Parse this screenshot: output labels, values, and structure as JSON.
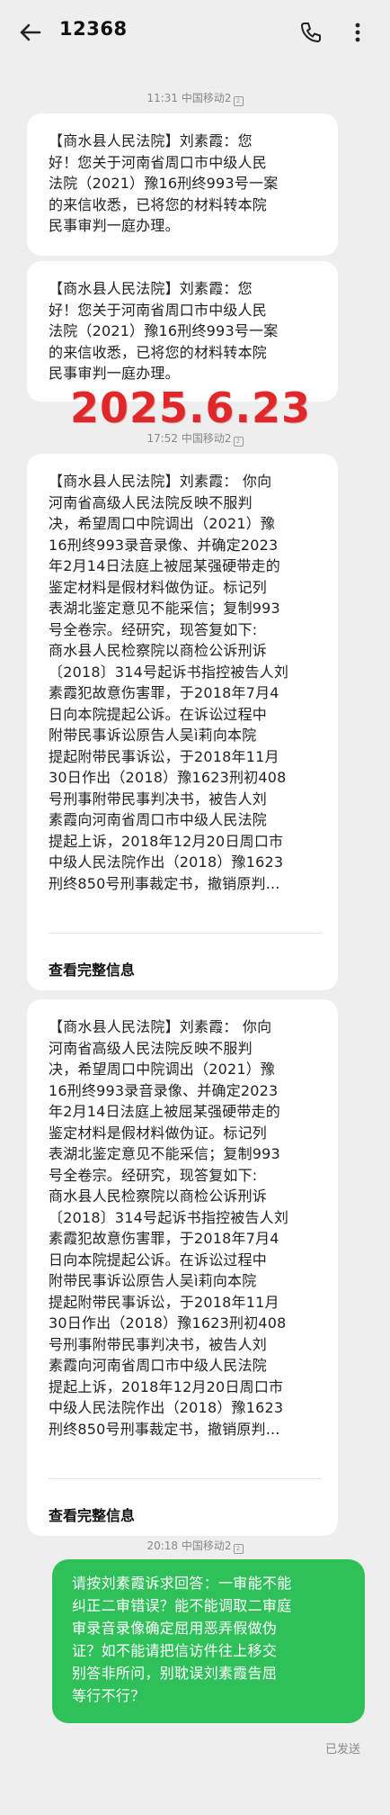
{
  "header": {
    "title": "12368",
    "back_icon": "back-arrow-icon",
    "call_icon": "phone-icon",
    "menu_icon": "more-vertical-icon"
  },
  "timestamps": {
    "t1": "11:31",
    "t2": "17:52",
    "t3": "20:18",
    "carrier": "中国移动2"
  },
  "stamp_date": "2025.6.23",
  "messages": {
    "m1": "【商水县人民法院】刘素霞：您\n好！您关于河南省周口市中级人民\n法院（2021）豫16刑终993号一案\n的来信收悉，已将您的材料转本院\n民事审判一庭办理。",
    "m2": "【商水县人民法院】刘素霞：您\n好！您关于河南省周口市中级人民\n法院（2021）豫16刑终993号一案\n的来信收悉，已将您的材料转本院\n民事审判一庭办理。",
    "m3": "【商水县人民法院】刘素霞： 你向\n河南省高级人民法院反映不服判\n决，希望周口中院调出（2021）豫\n16刑终993录音录像、并确定2023\n年2月14日法庭上被屈某强硬带走的\n鉴定材料是假材料做伪证。标记列\n表湖北鉴定意见不能采信；复制993\n号全卷宗。经研究，现答复如下:\n商水县人民检察院以商检公诉刑诉\n〔2018〕314号起诉书指控被告人刘\n素霞犯故意伤害罪，于2018年7月4\n日向本院提起公诉。在诉讼过程中\n附带民事诉讼原告人吴ì莉向本院\n提起附带民事诉讼，于2018年11月\n30日作出（2018）豫1623刑初408\n号刑事附带民事判决书，被告人刘\n素霞向河南省周口市中级人民法院\n提起上诉，2018年12月20日周口市\n中级人民法院作出（2018）豫1623\n刑终850号刑事裁定书，撤销原判...",
    "m3_link": "查看完整信息",
    "m4": "【商水县人民法院】刘素霞： 你向\n河南省高级人民法院反映不服判\n决，希望周口中院调出（2021）豫\n16刑终993录音录像、并确定2023\n年2月14日法庭上被屈某强硬带走的\n鉴定材料是假材料做伪证。标记列\n表湖北鉴定意见不能采信；复制993\n号全卷宗。经研究，现答复如下:\n商水县人民检察院以商检公诉刑诉\n〔2018〕314号起诉书指控被告人刘\n素霞犯故意伤害罪，于2018年7月4\n日向本院提起公诉。在诉讼过程中\n附带民事诉讼原告人吴ì莉向本院\n提起附带民事诉讼，于2018年11月\n30日作出（2018）豫1623刑初408\n号刑事附带民事判决书，被告人刘\n素霞向河南省周口市中级人民法院\n提起上诉，2018年12月20日周口市\n中级人民法院作出（2018）豫1623\n刑终850号刑事裁定书，撤销原判...",
    "m4_link": "查看完整信息",
    "sent": "请按刘素霞诉求回答：一审能不能\n纠正二审错误？能不能调取二审庭\n审录音录像确定屈用恶弄假做伪\n证？如不能请把信访件往上移交\n别答非所问，别耽误刘素霞告屈\n等行不行？",
    "sent_status": "已发送"
  },
  "colors": {
    "background": "#eeeeee",
    "incoming_bubble": "#ffffff",
    "outgoing_bubble": "#2fc05a",
    "stamp": "#e0282a"
  }
}
